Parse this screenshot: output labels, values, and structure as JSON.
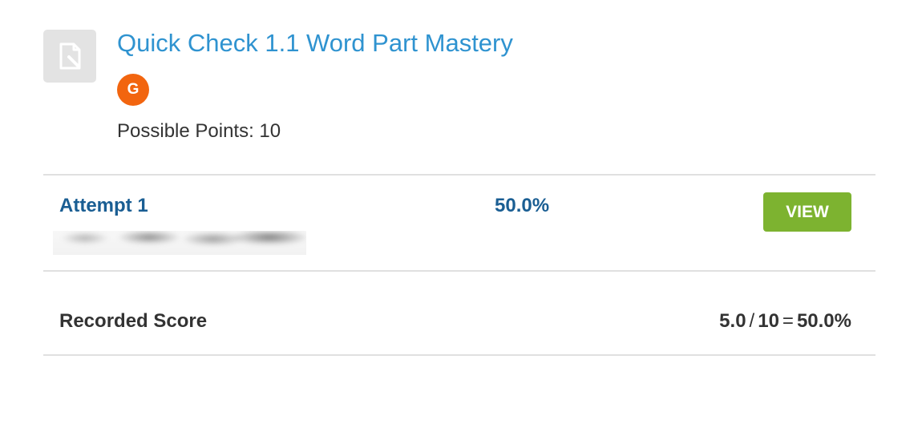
{
  "assignment": {
    "icon": "assignment-document-icon",
    "title": "Quick Check 1.1 Word Part Mastery",
    "badge_letter": "G",
    "possible_points": "Possible Points: 10"
  },
  "attempts": [
    {
      "label": "Attempt 1",
      "score": "50.0%",
      "view_label": "VIEW"
    }
  ],
  "recorded_score": {
    "label": "Recorded Score",
    "earned": "5.0",
    "slash": "/",
    "possible": "10",
    "equals": "=",
    "percent": "50.0%"
  },
  "colors": {
    "title": "#2f93d0",
    "badge": "#f2650f",
    "attempt_text": "#1a5e93",
    "view_button": "#7db330"
  }
}
